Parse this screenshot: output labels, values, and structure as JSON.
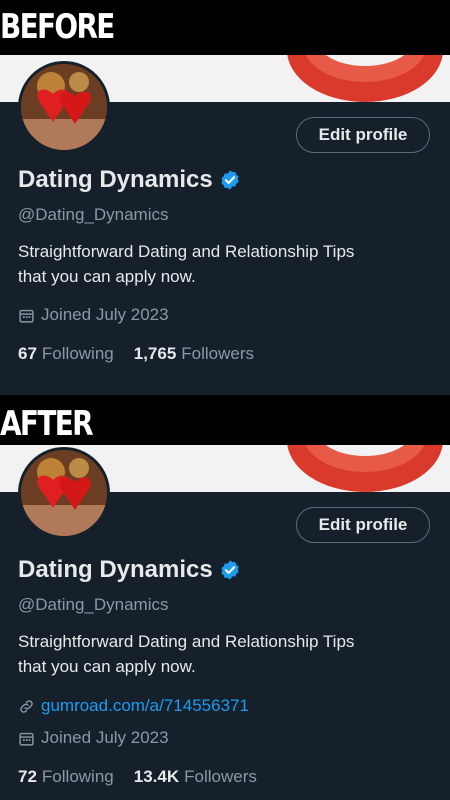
{
  "labels": {
    "before": "BEFORE",
    "after": "AFTER"
  },
  "colors": {
    "panel_bg": "#15202b",
    "accent_blue": "#1d9bf0",
    "text_primary": "#e7e9ea",
    "text_secondary": "#8b98a5"
  },
  "before": {
    "edit_button": "Edit profile",
    "display_name": "Dating Dynamics",
    "handle": "@Dating_Dynamics",
    "bio_line1": "Straightforward Dating and Relationship Tips",
    "bio_line2": "that you can apply now.",
    "joined": "Joined July 2023",
    "following_count": "67",
    "following_label": "Following",
    "followers_count": "1,765",
    "followers_label": "Followers"
  },
  "after": {
    "edit_button": "Edit profile",
    "display_name": "Dating Dynamics",
    "handle": "@Dating_Dynamics",
    "bio_line1": "Straightforward Dating and Relationship Tips",
    "bio_line2": "that you can apply now.",
    "link": "gumroad.com/a/714556371",
    "joined": "Joined July 2023",
    "following_count": "72",
    "following_label": "Following",
    "followers_count": "13.4K",
    "followers_label": "Followers"
  },
  "icons": {
    "verified": "verified-badge-icon",
    "calendar": "calendar-icon",
    "link": "link-icon"
  }
}
